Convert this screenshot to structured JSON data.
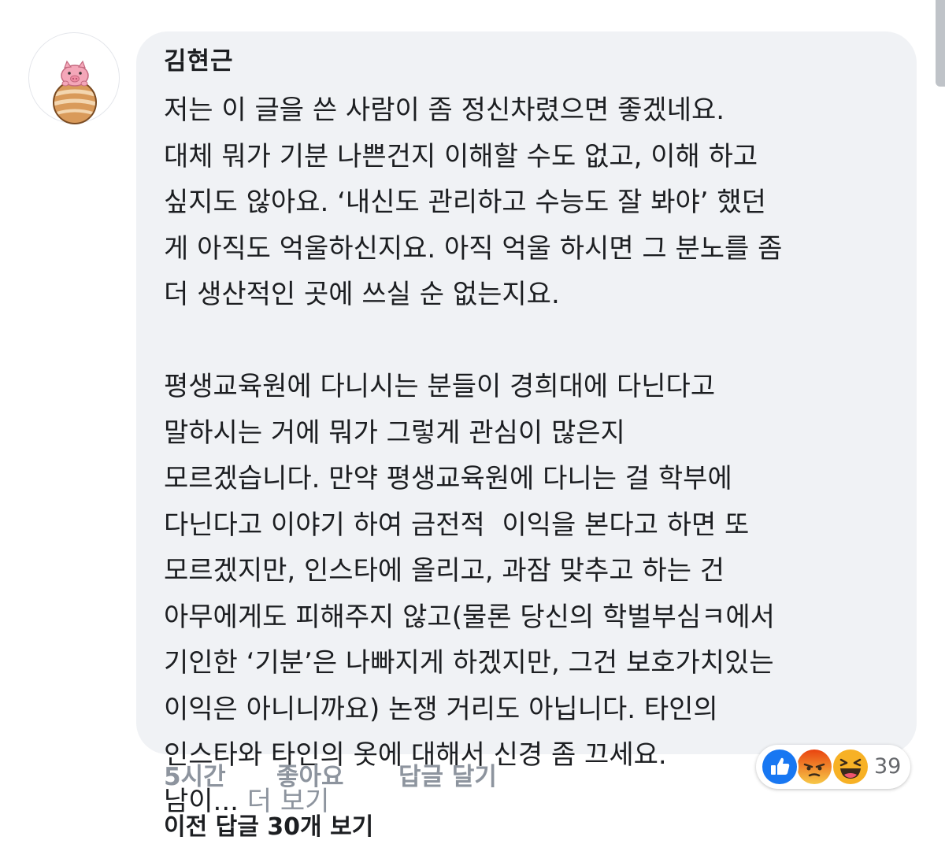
{
  "comment": {
    "author": "김현근",
    "avatar_icon": "pig-on-ball-icon",
    "paragraph1": [
      "저는 이 글을 쓴 사람이 좀 정신차렸으면 좋겠네요.",
      "대체 뭐가 기분 나쁜건지 이해할 수도 없고, 이해 하고",
      "싶지도 않아요. ‘내신도 관리하고 수능도 잘 봐야’ 했던",
      "게 아직도 억울하신지요. 아직 억울 하시면 그 분노를 좀",
      "더 생산적인 곳에 쓰실 순 없는지요."
    ],
    "paragraph2": [
      "평생교육원에 다니시는 분들이 경희대에 다닌다고",
      "말하시는 거에 뭐가 그렇게 관심이 많은지",
      "모르겠습니다. 만약 평생교육원에 다니는 걸 학부에",
      "다닌다고 이야기 하여 금전적  이익을 본다고 하면 또",
      "모르겠지만, 인스타에 올리고, 과잠 맞추고 하는 건",
      "아무에게도 피해주지 않고(물론 당신의 학벌부심ㅋ에서",
      "기인한 ‘기분’은 나빠지게 하겠지만, 그건 보호가치있는",
      "이익은 아니니까요) 논쟁 거리도 아닙니다. 타인의",
      "인스타와 타인의 옷에 대해서 신경 좀 끄세요."
    ],
    "truncated_text": "남이...",
    "see_more": "더 보기"
  },
  "actions": {
    "time": "5시간",
    "like": "좋아요",
    "reply": "답글 달기"
  },
  "reactions": {
    "icons": [
      "like-icon",
      "angry-icon",
      "haha-icon"
    ],
    "count": "39",
    "colors": {
      "like": "#1877f2",
      "angry": "#e9710f",
      "haha": "#f7b125"
    }
  },
  "prev_replies": "이전 답글 30개 보기"
}
